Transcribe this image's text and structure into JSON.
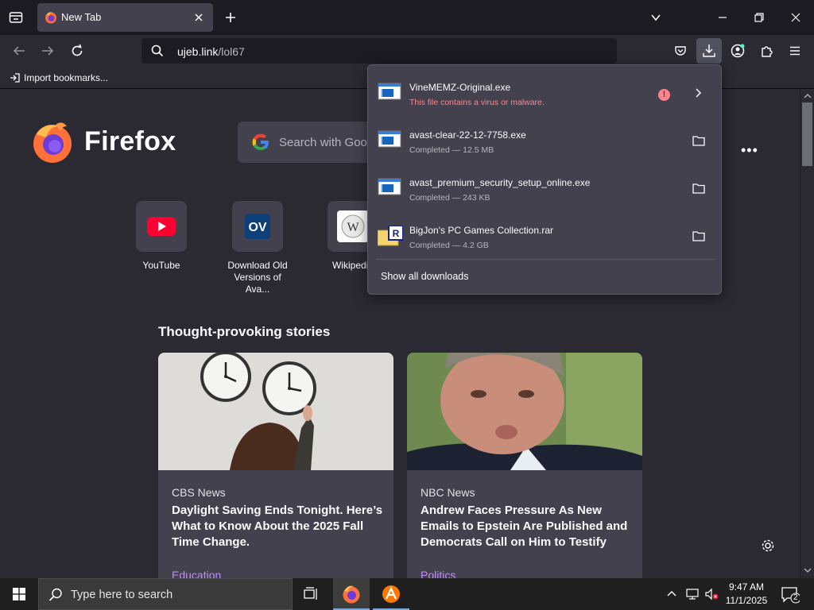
{
  "window": {
    "tab_title": "New Tab"
  },
  "navbar": {
    "url_host": "ujeb.link",
    "url_path": "/lol67"
  },
  "bookmarks": {
    "import_label": "Import bookmarks..."
  },
  "newtab": {
    "brand": "Firefox",
    "search_placeholder": "Search with Google or enter address",
    "shortcuts": [
      {
        "label": "YouTube",
        "icon": "youtube-icon"
      },
      {
        "label": "Download Old Versions of Ava...",
        "icon": "ov-icon"
      },
      {
        "label": "Wikipedia",
        "icon": "wikipedia-icon"
      }
    ],
    "stories_title": "Thought-provoking stories",
    "stories": [
      {
        "source": "CBS News",
        "headline": "Daylight Saving Ends Tonight. Here’s What to Know About the 2025 Fall Time Change.",
        "category": "Education"
      },
      {
        "source": "NBC News",
        "headline": "Andrew Faces Pressure As New Emails to Epstein Are Published and Democrats Call on Him to Testify",
        "category": "Politics"
      }
    ]
  },
  "downloads": {
    "items": [
      {
        "name": "VineMEMZ-Original.exe",
        "status": "This file contains a virus or malware.",
        "blocked": true
      },
      {
        "name": "avast-clear-22-12-7758.exe",
        "status": "Completed — 12.5 MB",
        "blocked": false
      },
      {
        "name": "avast_premium_security_setup_online.exe",
        "status": "Completed — 243 KB",
        "blocked": false
      },
      {
        "name": "BigJon's PC Games Collection.rar",
        "status": "Completed — 4.2 GB",
        "blocked": false
      }
    ],
    "show_all_label": "Show all downloads"
  },
  "taskbar": {
    "search_placeholder": "Type here to search",
    "time": "9:47 AM",
    "date": "11/1/2025",
    "notification_count": "2"
  },
  "colors": {
    "chrome_dark": "#1c1b22",
    "chrome": "#2b2a33",
    "panel": "#42414d",
    "danger": "#ff848b",
    "category": "#c18cff"
  }
}
